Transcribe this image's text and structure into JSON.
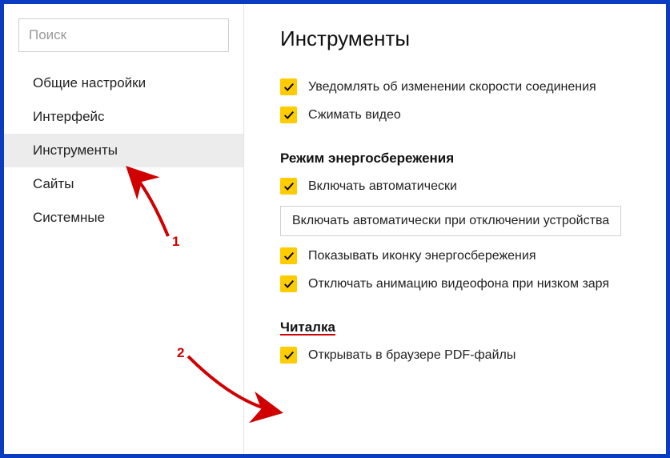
{
  "search": {
    "placeholder": "Поиск"
  },
  "sidebar": {
    "items": [
      {
        "label": "Общие настройки"
      },
      {
        "label": "Интерфейс"
      },
      {
        "label": "Инструменты"
      },
      {
        "label": "Сайты"
      },
      {
        "label": "Системные"
      }
    ]
  },
  "page": {
    "title": "Инструменты"
  },
  "options": {
    "notify_speed": "Уведомлять об изменении скорости соединения",
    "compress_video": "Сжимать видео"
  },
  "power": {
    "heading": "Режим энергосбережения",
    "auto_enable": "Включать автоматически",
    "dropdown": "Включать автоматически при отключении устройства",
    "show_icon": "Показывать иконку энергосбережения",
    "disable_anim": "Отключать анимацию видеофона при низком заря"
  },
  "reader": {
    "heading": "Читалка",
    "open_pdf": "Открывать в браузере PDF-файлы"
  },
  "annotations": {
    "one": "1",
    "two": "2"
  }
}
